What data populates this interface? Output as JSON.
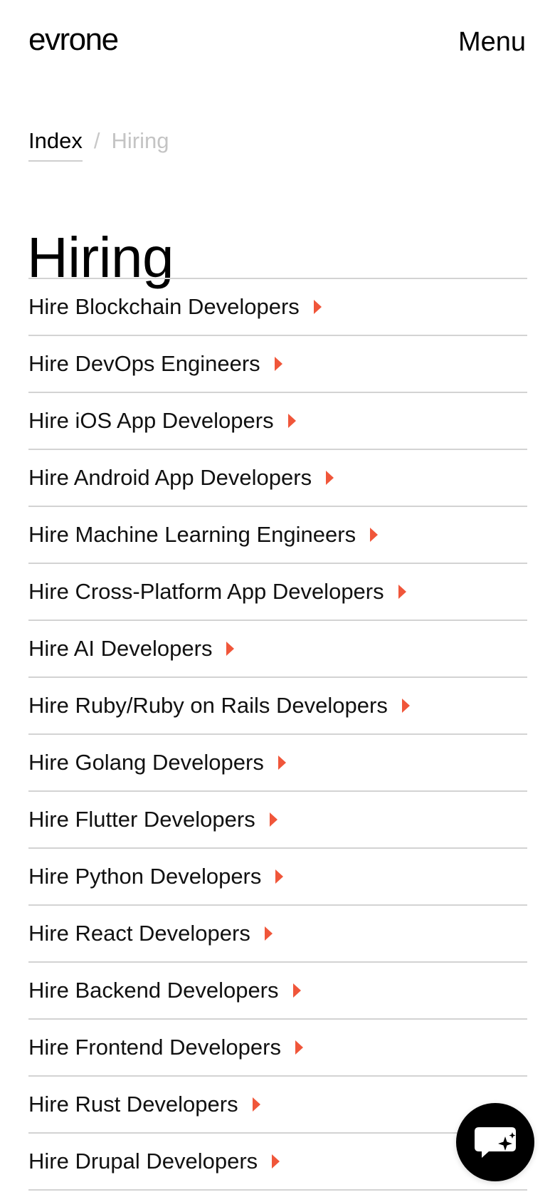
{
  "header": {
    "logo": "evrone",
    "menu_label": "Menu"
  },
  "breadcrumb": {
    "index_label": "Index",
    "separator": "/",
    "current_label": "Hiring"
  },
  "page": {
    "title": "Hiring"
  },
  "hiring_links": [
    {
      "label": "Hire Blockchain Developers"
    },
    {
      "label": "Hire DevOps Engineers"
    },
    {
      "label": "Hire iOS App Developers"
    },
    {
      "label": "Hire Android App Developers"
    },
    {
      "label": "Hire Machine Learning Engineers"
    },
    {
      "label": "Hire Cross-Platform App Developers"
    },
    {
      "label": "Hire AI Developers"
    },
    {
      "label": "Hire Ruby/Ruby on Rails Developers"
    },
    {
      "label": "Hire Golang Developers"
    },
    {
      "label": "Hire Flutter Developers"
    },
    {
      "label": "Hire Python Developers"
    },
    {
      "label": "Hire React Developers"
    },
    {
      "label": "Hire Backend Developers"
    },
    {
      "label": "Hire Frontend Developers"
    },
    {
      "label": "Hire Rust Developers"
    },
    {
      "label": "Hire Drupal Developers"
    }
  ],
  "icons": {
    "list_arrow": "caret-right-icon",
    "chat": "chat-sparkle-icon"
  },
  "colors": {
    "accent": "#f0563a",
    "divider": "#d3d3d3",
    "muted_text": "#c4c4c4"
  }
}
